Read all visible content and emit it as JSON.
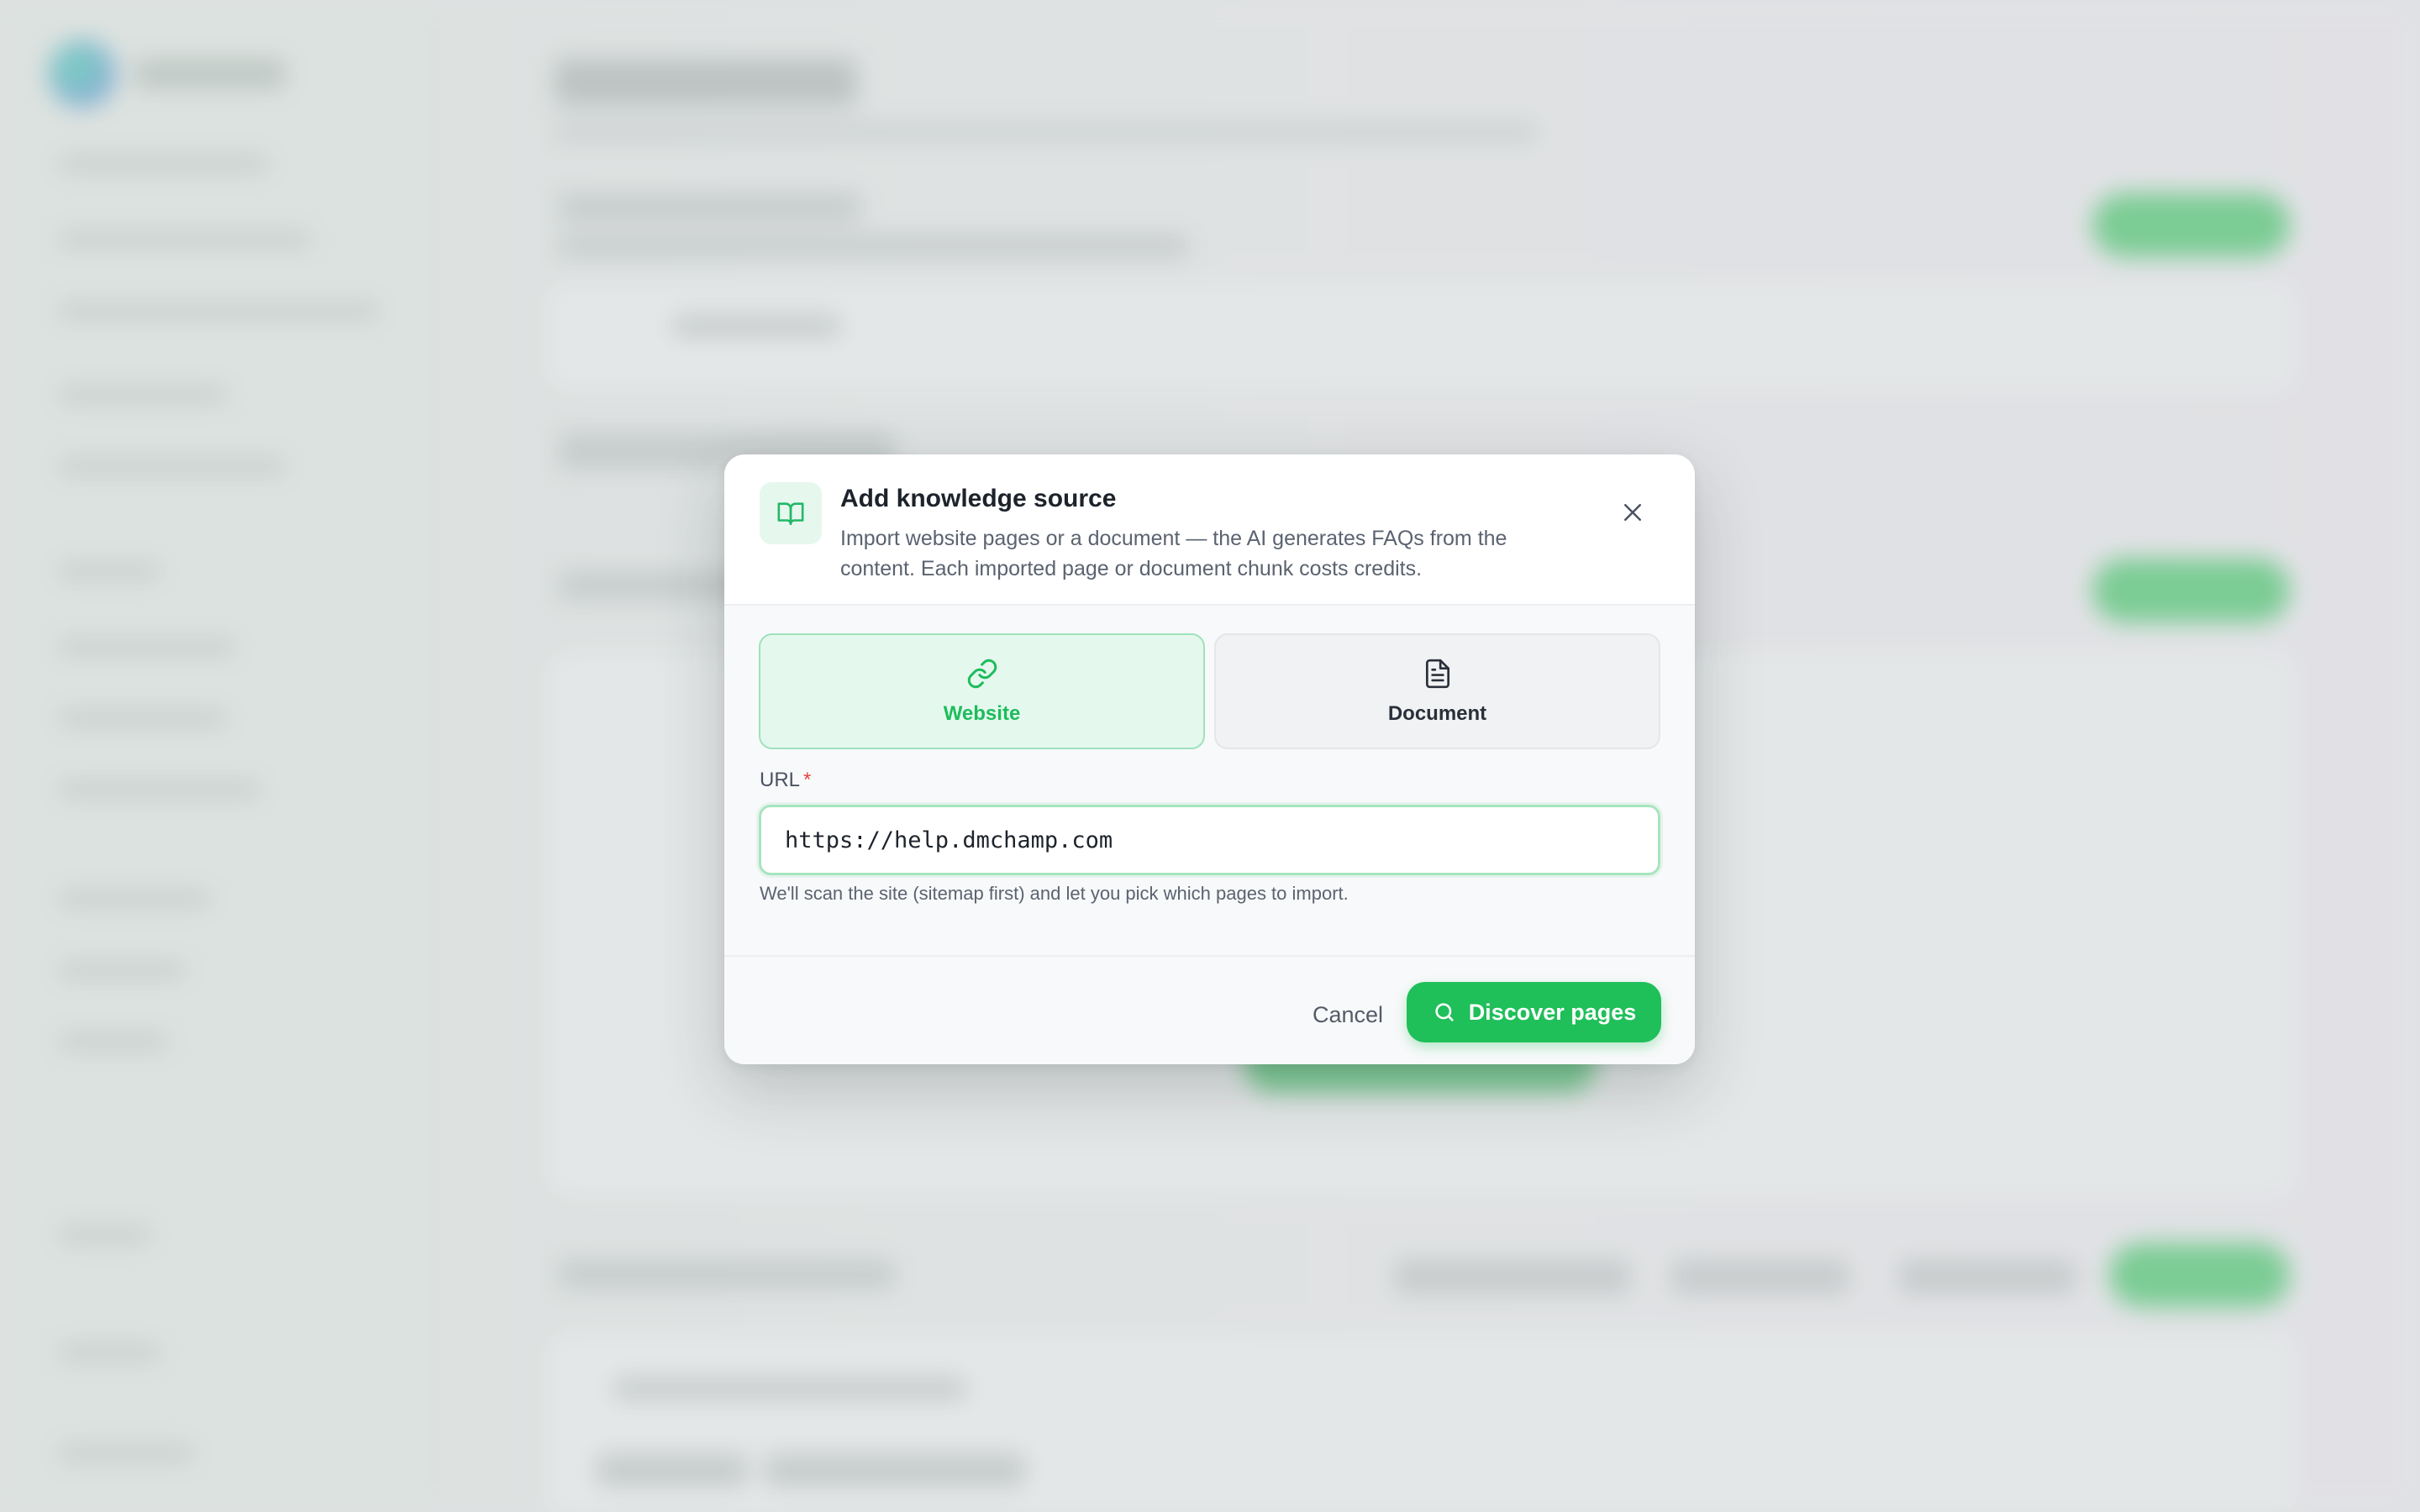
{
  "modal": {
    "title": "Add knowledge source",
    "subtitle": "Import website pages or a document — the AI generates FAQs from the content. Each imported page or document chunk costs credits.",
    "header_icon": "book-open-icon",
    "close_icon": "close-icon",
    "tabs": [
      {
        "label": "Website",
        "icon": "link-icon",
        "selected": true
      },
      {
        "label": "Document",
        "icon": "file-text-icon",
        "selected": false
      }
    ],
    "url_field": {
      "label": "URL",
      "required_mark": "*",
      "value": "https://help.dmchamp.com",
      "help": "We'll scan the site (sitemap first) and let you pick which pages to import."
    },
    "footer": {
      "cancel_label": "Cancel",
      "discover_label": "Discover pages",
      "discover_icon": "search-icon"
    }
  },
  "colors": {
    "accent": "#1fbf5a",
    "accent_light": "#e5f8ee",
    "required": "#e2463f"
  }
}
